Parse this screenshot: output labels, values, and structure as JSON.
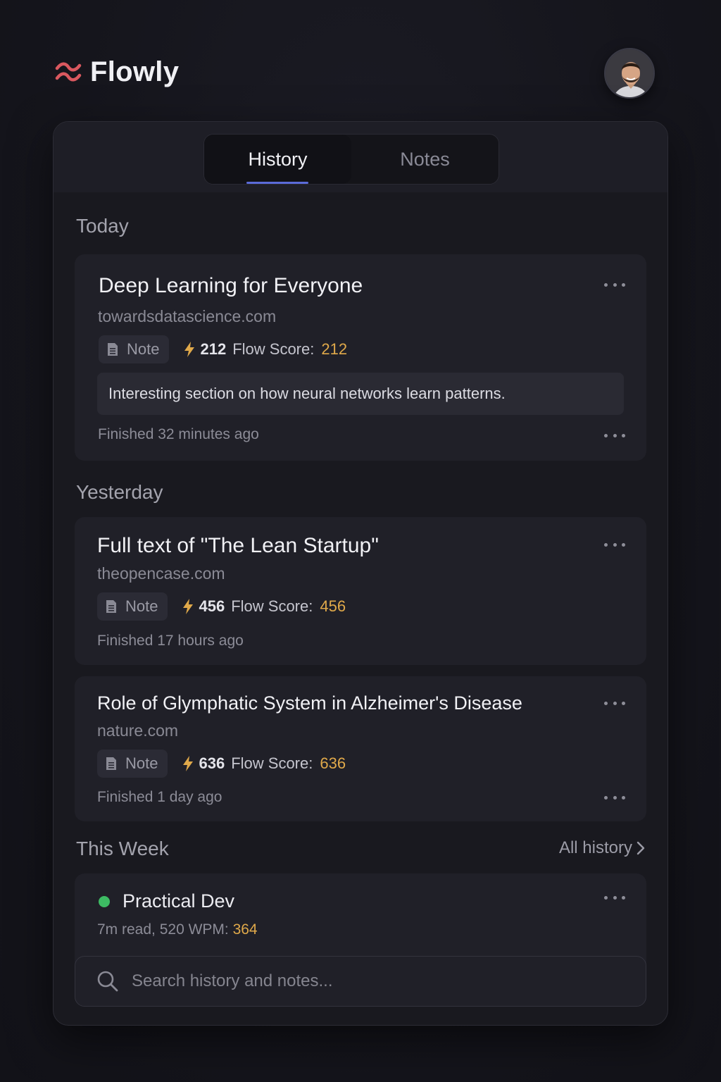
{
  "app": {
    "name": "Flowly",
    "brand_icon": "wave-icon"
  },
  "tabs": [
    {
      "label": "History",
      "active": true
    },
    {
      "label": "Notes",
      "active": false
    }
  ],
  "sections": {
    "today": "Today",
    "yesterday": "Yesterday",
    "this_week": "This Week"
  },
  "all_history_label": "All history",
  "items": [
    {
      "title": "Deep Learning for Everyone",
      "domain": "towardsdatascience.com",
      "note_label": "Note",
      "flow_number": "212",
      "flow_label": "Flow Score:",
      "flow_value": "212",
      "quote": "Interesting section on how neural networks learn patterns.",
      "finished": "Finished 32 minutes ago"
    },
    {
      "title": "Full text of \"The Lean Startup\"",
      "domain": "theopencase.com",
      "note_label": "Note",
      "flow_number": "456",
      "flow_label": "Flow Score:",
      "flow_value": "456",
      "finished": "Finished 17 hours ago"
    },
    {
      "title": "Role of Glymphatic System in Alzheimer's Disease",
      "domain": "nature.com",
      "note_label": "Note",
      "flow_number": "636",
      "flow_label": "Flow Score:",
      "flow_value": "636",
      "finished": "Finished 1 day ago"
    }
  ],
  "week_item": {
    "title": "Practical Dev",
    "status_color": "#3dbb63",
    "meta_text": "7m read, 520 WPM:",
    "meta_value": "364"
  },
  "search": {
    "placeholder": "Search history and notes..."
  },
  "colors": {
    "accent": "#5b6bd8",
    "flow_score": "#e0a94a",
    "brand": "#d9585f"
  }
}
